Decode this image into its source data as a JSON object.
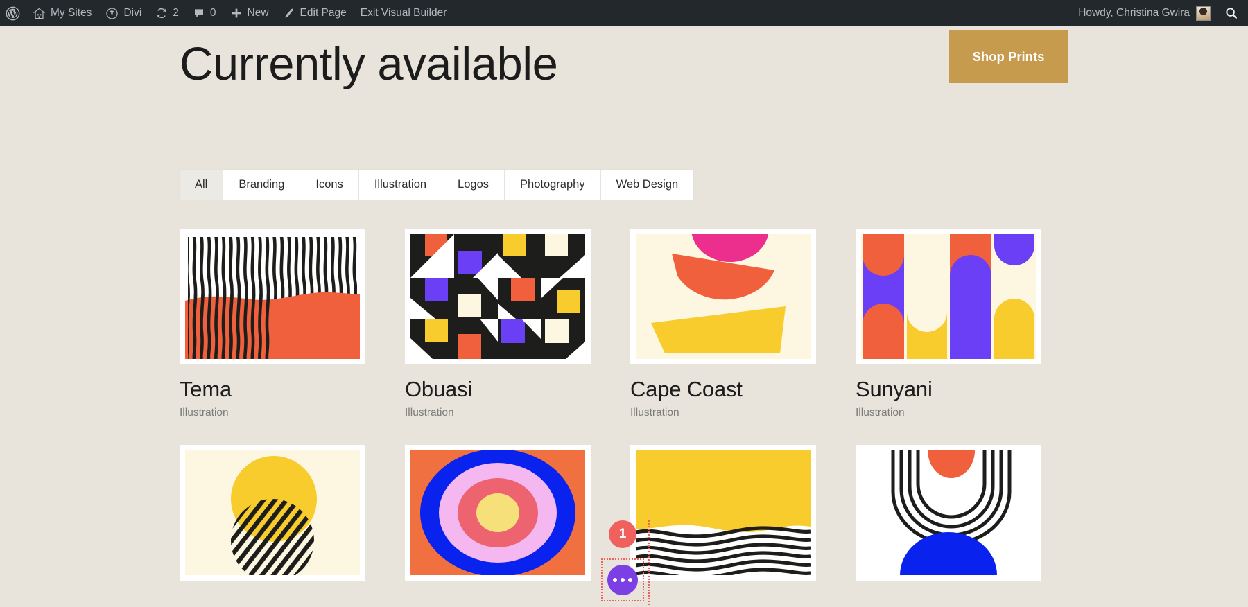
{
  "admin_bar": {
    "items": [
      {
        "icon": "wordpress-logo-icon",
        "label": ""
      },
      {
        "icon": "my-sites-icon",
        "label": "My Sites"
      },
      {
        "icon": "divi-icon",
        "label": "Divi"
      },
      {
        "icon": "updates-icon",
        "label": "2"
      },
      {
        "icon": "comments-icon",
        "label": "0"
      },
      {
        "icon": "plus-icon",
        "label": "New"
      },
      {
        "icon": "pencil-icon",
        "label": "Edit Page"
      },
      {
        "icon": "",
        "label": "Exit Visual Builder"
      }
    ],
    "howdy": "Howdy, Christina Gwira",
    "avatar_name": "avatar",
    "search_icon": "search-icon",
    "background": "#23282d",
    "text_color": "#b4b9be"
  },
  "header": {
    "title": "Currently available",
    "cta_label": "Shop Prints",
    "cta_color": "#c79b4e"
  },
  "filters": {
    "tabs": [
      {
        "label": "All",
        "active": true
      },
      {
        "label": "Branding",
        "active": false
      },
      {
        "label": "Icons",
        "active": false
      },
      {
        "label": "Illustration",
        "active": false
      },
      {
        "label": "Logos",
        "active": false
      },
      {
        "label": "Photography",
        "active": false
      },
      {
        "label": "Web Design",
        "active": false
      }
    ]
  },
  "gallery": {
    "rows": [
      [
        {
          "title": "Tema",
          "category": "Illustration",
          "art": "wavy-vertical"
        },
        {
          "title": "Obuasi",
          "category": "Illustration",
          "art": "quilt"
        },
        {
          "title": "Cape Coast",
          "category": "Illustration",
          "art": "bowls"
        },
        {
          "title": "Sunyani",
          "category": "Illustration",
          "art": "arches"
        }
      ],
      [
        {
          "title": "",
          "category": "",
          "art": "sun"
        },
        {
          "title": "",
          "category": "",
          "art": "target"
        },
        {
          "title": "",
          "category": "",
          "art": "waves"
        },
        {
          "title": "",
          "category": "",
          "art": "arcs"
        }
      ]
    ]
  },
  "module_overlay": {
    "count": "1",
    "count_color": "#f0605d",
    "settings_icon": "ellipsis-icon",
    "settings_color": "#7b3fe4"
  },
  "palette": {
    "page_background": "#e8e4dc",
    "orange": "#f0603c",
    "yellow": "#f7cc2c",
    "purple": "#6b3ff5",
    "cream": "#fdf6e0",
    "black": "#1d1d1b",
    "pink": "#ec2f8c",
    "blue": "#0a22ee",
    "light_pink": "#f4b7ef",
    "rose": "#ed6370"
  }
}
